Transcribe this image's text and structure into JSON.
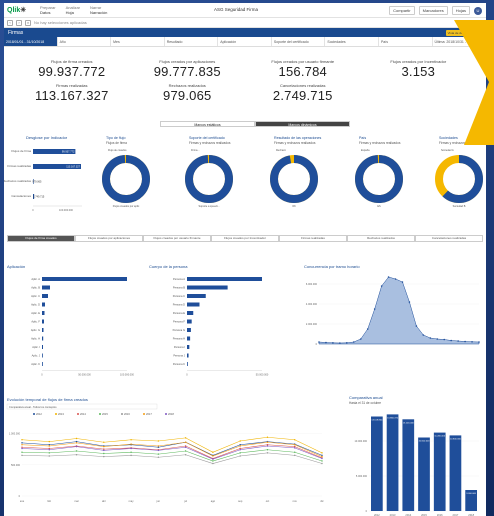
{
  "app": {
    "logo": "Qlik",
    "nav_sections": [
      {
        "label": "Preparar",
        "value": "Datos"
      },
      {
        "label": "Analizar",
        "value": "Hoja"
      },
      {
        "label": "Narrar",
        "value": "Narración"
      }
    ],
    "title": "ASG Seguridad Firma",
    "share": "Compartir",
    "bookmarks": "Marcadores",
    "sheets": "Hojas",
    "user_initial": "U"
  },
  "toolbar": {
    "hint": "No hay selecciones aplicadas"
  },
  "sheet": {
    "title": "Firmas",
    "pill1": "Vista de datos",
    "pill2": "Ayuda"
  },
  "filters": [
    {
      "label": "2018/01/01 - 31/10/2018",
      "dark": true
    },
    {
      "label": "Año",
      "dark": false
    },
    {
      "label": "Mes",
      "dark": false
    },
    {
      "label": "Resultado",
      "dark": false
    },
    {
      "label": "Aplicación",
      "dark": false
    },
    {
      "label": "Soporte del certificado",
      "dark": false
    },
    {
      "label": "Sociedades",
      "dark": false
    },
    {
      "label": "País",
      "dark": false
    },
    {
      "label": "Última: 2018/10/31 - 23:59:59",
      "dark": false
    }
  ],
  "kpis": [
    {
      "top_label": "Flujos de firma creados",
      "top_value": "99.937.772",
      "bottom_label": "Firmas realizadas",
      "bottom_value": "113.167.327"
    },
    {
      "top_label": "Flujos creados por aplicaciones",
      "top_value": "99.777.835",
      "bottom_label": "Rechazos realizados",
      "bottom_value": "979.065"
    },
    {
      "top_label": "Flujos creados por usuario firmante",
      "top_value": "156.784",
      "bottom_label": "Cancelaciones realizadas",
      "bottom_value": "2.749.715"
    },
    {
      "top_label": "Flujos creados por Incentivador",
      "top_value": "3.153",
      "bottom_label": "",
      "bottom_value": ""
    }
  ],
  "toggle": {
    "left": "Marcos estáticos",
    "right": "Marcos dinámicos"
  },
  "mid_charts": {
    "bar": {
      "title": "Desglose por Indicador",
      "categories": [
        "Flujos de firma",
        "Firmas realizadas",
        "Rechazos realizados",
        "Cancelaciones"
      ],
      "values": [
        99937772,
        113167327,
        979065,
        2749715
      ],
      "labels": [
        "99.937.772",
        "113.167.327",
        "979.065",
        "2.749.715"
      ],
      "xticks": [
        "0",
        "100.000.000"
      ]
    },
    "donuts": [
      {
        "title": "Tipo de flujo",
        "subtitle": "Flujos de firma",
        "label_a": "Flujo de creados",
        "label_b": "Flujos creados por aplic",
        "fraction": 0.99
      },
      {
        "title": "Soporte del certificado",
        "subtitle": "Firmas y rechazos realizados",
        "label_a": "Firma...",
        "label_b": "Soporte a speedi...",
        "fraction": 0.99
      },
      {
        "title": "Resultado de las operaciones",
        "subtitle": "Firmas y rechazos realizados",
        "label_a": "Rechazo",
        "label_b": "OK",
        "fraction": 0.97
      },
      {
        "title": "País",
        "subtitle": "Firmas y rechazos realizados",
        "label_a": "España",
        "label_b": "ES",
        "fraction": 0.99
      },
      {
        "title": "Sociedades",
        "subtitle": "Firmas y rechazos realizados",
        "label_a": "Sociedad A",
        "label_b": "Sociedad B",
        "fraction": 0.62
      }
    ]
  },
  "tabs": [
    {
      "label": "Flujos de firma creados",
      "active": true
    },
    {
      "label": "Flujos creados por aplicaciones",
      "active": false
    },
    {
      "label": "Flujos creados por usuario firmante",
      "active": false
    },
    {
      "label": "Flujos creados por Incentivador",
      "active": false
    },
    {
      "label": "Firmas realizadas",
      "active": false
    },
    {
      "label": "Rechazos realizados",
      "active": false
    },
    {
      "label": "Cancelaciones realizadas",
      "active": false
    }
  ],
  "chart_data": [
    {
      "type": "bar",
      "title": "Aplicación",
      "categories": [
        "Aplic. A",
        "Aplic. B",
        "Aplic. C",
        "Aplic. D",
        "Aplic. E",
        "Aplic. F",
        "Aplic. G",
        "Aplic. H",
        "Aplic. I",
        "Aplic. J",
        "Aplic. K"
      ],
      "values": [
        85000000,
        8000000,
        6000000,
        3000000,
        2500000,
        2000000,
        1500000,
        1200000,
        1000000,
        800000,
        500000
      ],
      "xticks": [
        "0",
        "50.000.000",
        "100.000.000"
      ]
    },
    {
      "type": "bar",
      "title": "Cuerpo de la persona",
      "categories": [
        "Persona A",
        "Persona B",
        "Persona C",
        "Persona D",
        "Persona E",
        "Persona F",
        "Persona G",
        "Persona H",
        "Persona I",
        "Persona J",
        "Persona K"
      ],
      "values": [
        48000000,
        26000000,
        12000000,
        8000000,
        4000000,
        3000000,
        2500000,
        2000000,
        1500000,
        1000000,
        500000
      ],
      "xticks": [
        "0",
        "50.000.000"
      ]
    },
    {
      "type": "area",
      "title": "Concurrencia por tramo horario",
      "x": [
        0,
        1,
        2,
        3,
        4,
        5,
        6,
        7,
        8,
        9,
        10,
        11,
        12,
        13,
        14,
        15,
        16,
        17,
        18,
        19,
        20,
        21,
        22,
        23
      ],
      "values": [
        200000,
        150000,
        120000,
        100000,
        120000,
        200000,
        500000,
        1500000,
        3500000,
        5800000,
        6700000,
        6500000,
        6200000,
        4200000,
        1800000,
        900000,
        600000,
        500000,
        450000,
        350000,
        300000,
        250000,
        220000,
        200000
      ],
      "yticks": [
        "0",
        "2.000.000",
        "4.000.000",
        "6.000.000"
      ]
    },
    {
      "type": "line",
      "title": "Evolución temporal de flujos de firma creados",
      "dropdown": "Comparativa anual - Todos los conceptos",
      "categories": [
        "ene",
        "feb",
        "mar",
        "abr",
        "may",
        "jun",
        "jul",
        "ago",
        "sep",
        "oct",
        "nov",
        "dic"
      ],
      "series": [
        {
          "name": "2012",
          "color": "#1f4e9a",
          "values": [
            850000,
            820000,
            870000,
            800000,
            820000,
            780000,
            860000,
            650000,
            820000,
            870000,
            830000,
            650000
          ]
        },
        {
          "name": "2013",
          "color": "#f0b400",
          "values": [
            900000,
            870000,
            920000,
            860000,
            900000,
            880000,
            930000,
            700000,
            880000,
            940000,
            900000,
            690000
          ]
        },
        {
          "name": "2014",
          "color": "#d9534f",
          "values": [
            780000,
            760000,
            800000,
            750000,
            770000,
            740000,
            800000,
            600000,
            760000,
            820000,
            790000,
            610000
          ]
        },
        {
          "name": "2015",
          "color": "#5cb85c",
          "values": [
            700000,
            690000,
            720000,
            680000,
            700000,
            670000,
            720000,
            560000,
            690000,
            740000,
            700000,
            560000
          ]
        },
        {
          "name": "2016",
          "color": "#999999",
          "values": [
            650000,
            640000,
            660000,
            630000,
            650000,
            620000,
            660000,
            520000,
            640000,
            690000,
            650000,
            520000
          ]
        },
        {
          "name": "2017",
          "color": "#f39c12",
          "values": [
            820000,
            800000,
            850000,
            790000,
            830000,
            800000,
            860000,
            640000,
            800000,
            860000,
            820000,
            630000
          ]
        },
        {
          "name": "2018",
          "color": "#7e57c2",
          "values": [
            760000,
            740000,
            790000,
            730000,
            760000,
            730000,
            780000,
            590000,
            740000,
            800000,
            770000,
            600000
          ]
        }
      ],
      "yticks": [
        "0",
        "500.000",
        "1.000.000"
      ]
    },
    {
      "type": "bar",
      "title": "Comparativa anual",
      "subtitle": "Hasta el 31 de octubre",
      "categories": [
        "2012",
        "2013",
        "2014",
        "2015",
        "2016",
        "2017",
        "2018"
      ],
      "values": [
        13500000,
        13800000,
        13100000,
        10500000,
        11200000,
        10800000,
        3000000
      ],
      "labels": [
        "13.519.804",
        "13.860.372",
        "13.100.000",
        "10.500.000",
        "11.200.000",
        "10.800.000",
        "3.000.000"
      ],
      "yticks": [
        "0",
        "5.000.000",
        "10.000.000"
      ]
    }
  ]
}
